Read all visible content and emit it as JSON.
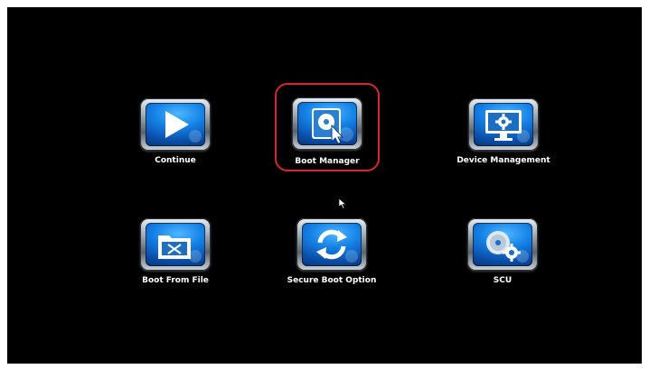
{
  "tiles": [
    {
      "label": "Continue",
      "icon": "play-icon",
      "selected": false
    },
    {
      "label": "Boot Manager",
      "icon": "disk-pointer-icon",
      "selected": true
    },
    {
      "label": "Device Management",
      "icon": "monitor-gear-icon",
      "selected": false
    },
    {
      "label": "Boot From File",
      "icon": "folder-file-icon",
      "selected": false
    },
    {
      "label": "Secure Boot Option",
      "icon": "refresh-arrows-icon",
      "selected": false
    },
    {
      "label": "SCU",
      "icon": "disc-gears-icon",
      "selected": false
    }
  ],
  "colors": {
    "background": "#000000",
    "selection": "#d8262d",
    "icon_blue": "#1481e6",
    "label": "#ffffff"
  }
}
